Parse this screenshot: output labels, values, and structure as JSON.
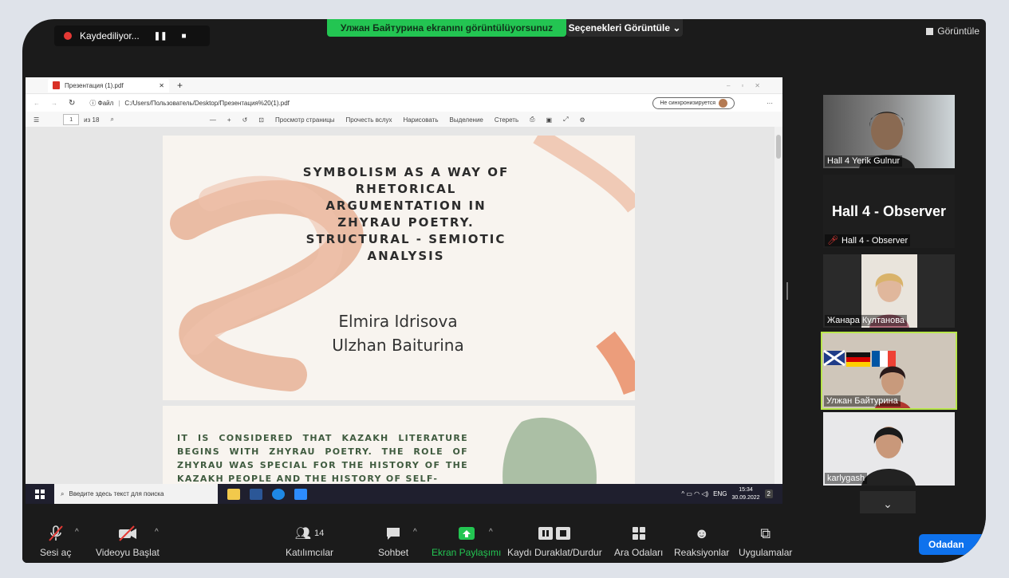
{
  "recording": {
    "label": "Kaydediliyor...",
    "pause": "❚❚",
    "stop": "■"
  },
  "share_banner": "Улжан Байтурина ekranını görüntülüyorsunuz",
  "options_button": "Seçenekleri Görüntüle ⌄",
  "view_button": "Görüntüle",
  "browser": {
    "tab_title": "Презентация (1).pdf",
    "url_prefix": "Файл",
    "url": "C:/Users/Пользователь/Desktop/Презентация%20(1).pdf",
    "sync_label": "Не синхронизируется",
    "page_number": "1",
    "page_total": "из 18",
    "view_page": "Просмотр страницы",
    "read_aloud": "Прочесть вслух",
    "draw": "Нарисовать",
    "highlight": "Выделение",
    "erase": "Стереть"
  },
  "slide1": {
    "title_lines": [
      "SYMBOLISM AS A WAY OF",
      "RHETORICAL",
      "ARGUMENTATION IN",
      "ZHYRAU POETRY.",
      "STRUCTURAL - SEMIOTIC",
      "ANALYSIS"
    ],
    "author1": "Elmira Idrisova",
    "author2": "Ulzhan Baiturina"
  },
  "slide2": {
    "text": "IT IS CONSIDERED THAT KAZAKH LITERATURE BEGINS WITH ZHYRAU POETRY. THE ROLE OF ZHYRAU WAS SPECIAL FOR THE HISTORY OF THE KAZAKH PEOPLE AND THE HISTORY OF SELF-"
  },
  "taskbar": {
    "search_placeholder": "Введите здесь текст для поиска",
    "lang": "ENG",
    "time": "15:34",
    "date": "30.09.2022",
    "notifications": "2"
  },
  "participants": [
    {
      "name": "Hall 4 Yerik Gulnur"
    },
    {
      "name": "Hall 4 - Observer",
      "title": "Hall 4 - Observer",
      "muted": true
    },
    {
      "name": "Жанара Култанова"
    },
    {
      "name": "Улжан Байтурина",
      "active": true
    },
    {
      "name": "karlygash"
    }
  ],
  "toolbar": {
    "mute": "Sesi aç",
    "video": "Videoyu Başlat",
    "participants": "Katılımcılar",
    "participants_count": "14",
    "chat": "Sohbet",
    "share": "Ekran Paylaşımı",
    "record": "Kaydı Duraklat/Durdur",
    "breakout": "Ara Odaları",
    "reactions": "Reaksiyonlar",
    "apps": "Uygulamalar",
    "leave": "Odadan"
  },
  "colors": {
    "share_green": "#23c552",
    "leave_blue": "#0e72ed",
    "slide2_text": "#3f5b3f"
  }
}
